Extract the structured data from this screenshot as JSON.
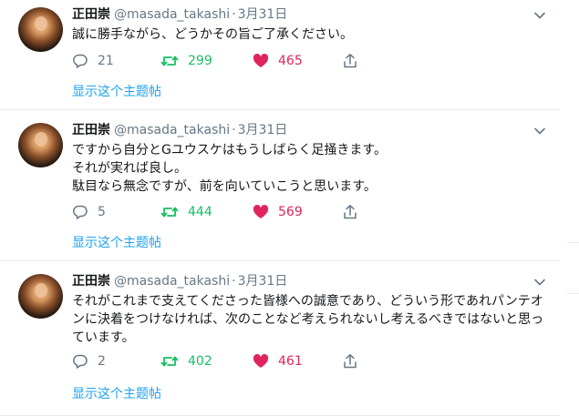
{
  "tweets": [
    {
      "name": "正田崇",
      "handle": "@masada_takashi",
      "separator": "·",
      "date": "3月31日",
      "text": "誠に勝手ながら、どうかその旨ご了承ください。",
      "replies": "21",
      "retweets": "299",
      "likes": "465",
      "thread_link": "显示这个主题帖"
    },
    {
      "name": "正田崇",
      "handle": "@masada_takashi",
      "separator": "·",
      "date": "3月31日",
      "text": "ですから自分とGユウスケはもうしばらく足掻きます。\nそれが実れば良し。\n駄目なら無念ですが、前を向いていこうと思います。",
      "replies": "5",
      "retweets": "444",
      "likes": "569",
      "thread_link": "显示这个主题帖"
    },
    {
      "name": "正田崇",
      "handle": "@masada_takashi",
      "separator": "·",
      "date": "3月31日",
      "text": "それがこれまで支えてくださった皆様への誠意であり、どういう形であれパンテオンに決着をつけなければ、次のことなど考えられないし考えるべきではないと思っています。",
      "replies": "2",
      "retweets": "402",
      "likes": "461",
      "thread_link": "显示这个主题帖"
    }
  ],
  "icons": {
    "reply": "reply-icon",
    "retweet": "retweet-icon",
    "like": "heart-icon",
    "share": "share-icon",
    "caret": "chevron-down-icon"
  },
  "colors": {
    "link": "#1da1f2",
    "retweet": "#17bf63",
    "like": "#e0245e",
    "muted": "#657786"
  }
}
